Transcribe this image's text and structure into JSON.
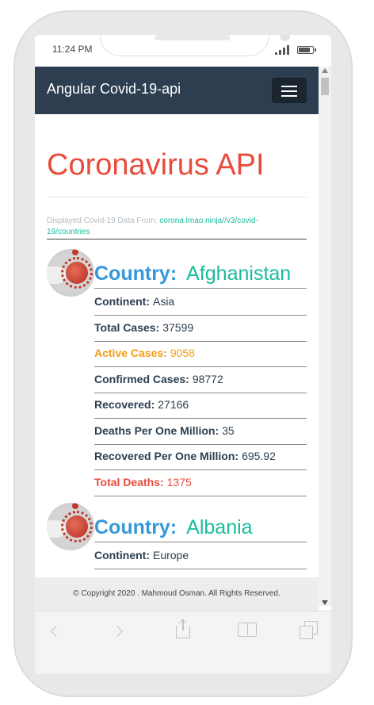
{
  "status_bar": {
    "time": "11:24 PM"
  },
  "navbar": {
    "brand": "Angular Covid-19-api"
  },
  "page": {
    "title": "Coronavirus API",
    "source_prefix": "Displayed Covid-19 Data From:",
    "source_link": "corona.lmao.ninja//v3/covid-19/countries"
  },
  "countries": [
    {
      "label": "Country:",
      "name": "Afghanistan",
      "stats": [
        {
          "label": "Continent:",
          "value": "Asia"
        },
        {
          "label": "Total Cases:",
          "value": "37599"
        },
        {
          "label": "Active Cases:",
          "value": "9058"
        },
        {
          "label": "Confirmed Cases:",
          "value": "98772"
        },
        {
          "label": "Recovered:",
          "value": "27166"
        },
        {
          "label": "Deaths Per One Million:",
          "value": "35"
        },
        {
          "label": "Recovered Per One Million:",
          "value": "695.92"
        },
        {
          "label": "Total Deaths:",
          "value": "1375"
        }
      ]
    },
    {
      "label": "Country:",
      "name": "Albania",
      "stats": [
        {
          "label": "Continent:",
          "value": "Europe"
        }
      ]
    }
  ],
  "footer": {
    "text": "© Copyright 2020 . Mahmoud Osman. All Rights Reserved."
  },
  "colors": {
    "navbar": "#2c3e50",
    "title": "#e74c3c",
    "country_label": "#3498db",
    "country_name": "#18bc9c",
    "active": "#f39c12",
    "deaths": "#e74c3c",
    "link": "#18bc9c"
  },
  "icons": [
    "hamburger-menu-icon",
    "signal-icon",
    "battery-icon",
    "back-arrow-icon",
    "forward-arrow-icon",
    "share-icon",
    "bookmarks-icon",
    "tabs-icon"
  ]
}
